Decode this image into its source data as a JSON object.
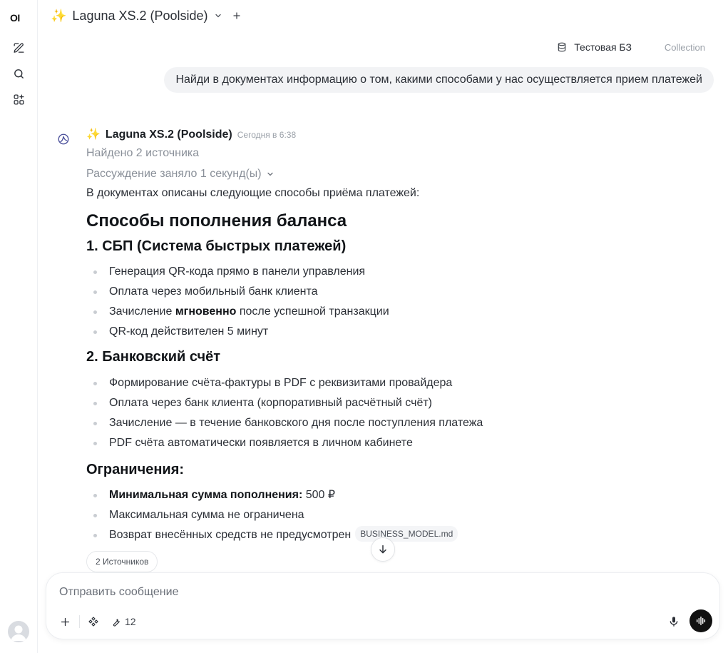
{
  "sidebar": {
    "logo": "OI",
    "items": [
      {
        "name": "new-chat",
        "icon": "edit-icon"
      },
      {
        "name": "search",
        "icon": "search-icon"
      },
      {
        "name": "workspace",
        "icon": "apps-icon"
      }
    ]
  },
  "header": {
    "model_emoji": "✨",
    "model_name": "Laguna XS.2 (Poolside)"
  },
  "knowledge": {
    "name": "Тестовая БЗ",
    "type": "Collection"
  },
  "user_message": "Найди в документах информацию о том, какими способами у нас осуществляется прием платежей",
  "assistant": {
    "emoji": "✨",
    "name": "Laguna XS.2 (Poolside)",
    "time": "Сегодня в 6:38",
    "sources_found": "Найдено 2 источника",
    "reasoning": "Рассуждение заняло 1 секунд(ы)",
    "intro": "В документах описаны следующие способы приёма платежей:",
    "h1": "Способы пополнения баланса",
    "section1": {
      "title": "1. СБП (Система быстрых платежей)",
      "items": [
        "Генерация QR-кода прямо в панели управления",
        "Оплата через мобильный банк клиента"
      ],
      "item3_pre": "Зачисление ",
      "item3_bold": "мгновенно",
      "item3_post": " после успешной транзакции",
      "item4": "QR-код действителен 5 минут"
    },
    "section2": {
      "title": "2. Банковский счёт",
      "items": [
        "Формирование счёта-фактуры в PDF с реквизитами провайдера",
        "Оплата через банк клиента (корпоративный расчётный счёт)",
        "Зачисление — в течение банковского дня после поступления платежа",
        "PDF счёта автоматически появляется в личном кабинете"
      ]
    },
    "section3": {
      "title": "Ограничения:",
      "item1_bold": "Минимальная сумма пополнения:",
      "item1_rest": " 500 ₽",
      "item2": "Максимальная сумма не ограничена",
      "item3": "Возврат внесённых средств не предусмотрен",
      "citation": "BUSINESS_MODEL.md"
    },
    "sources_button": "2 Источников"
  },
  "composer": {
    "placeholder": "Отправить сообщение",
    "tools_count": "12"
  }
}
